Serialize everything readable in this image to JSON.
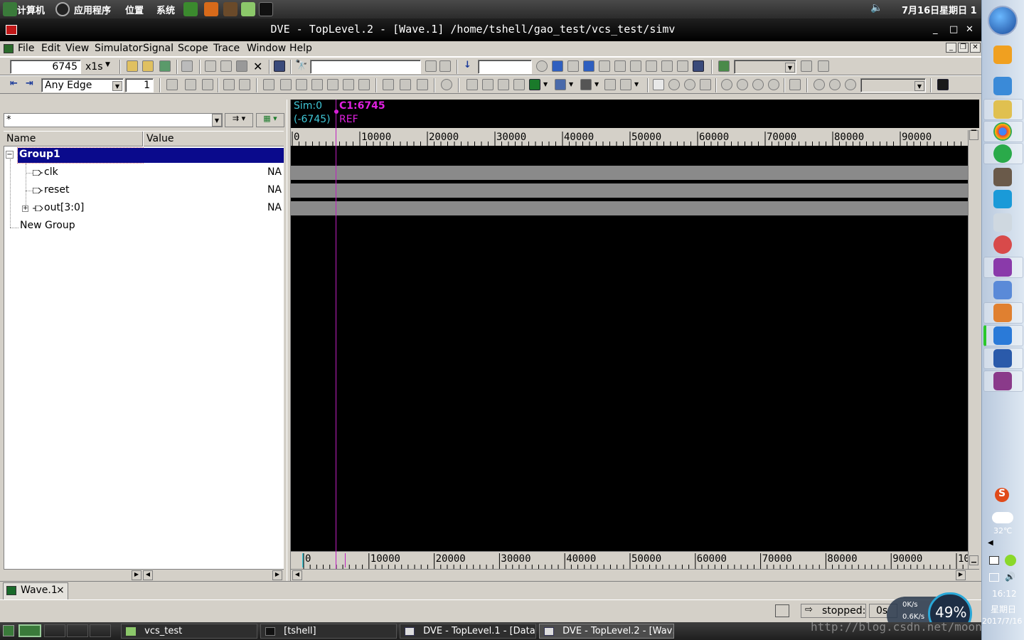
{
  "top_panel": {
    "computer": "计算机",
    "apps": "应用程序",
    "places": "位置",
    "system": "系统",
    "datetime": "7月16日星期日 1"
  },
  "window": {
    "title": "DVE - TopLevel.2 - [Wave.1]  /home/tshell/gao_test/vcs_test/simv",
    "minimize": "_",
    "maximize": "□",
    "close": "✕"
  },
  "menu": [
    "File",
    "Edit",
    "View",
    "Simulator",
    "Signal",
    "Scope",
    "Trace",
    "Window",
    "Help"
  ],
  "toolbar1": {
    "time_value": "6745",
    "time_unit": "x1s",
    "search_value": "",
    "goto_value": ""
  },
  "toolbar2": {
    "edge_select": "Any Edge",
    "edge_count": "1"
  },
  "signal_pane": {
    "filter_value": "*",
    "col_name": "Name",
    "col_value": "Value",
    "rows": [
      {
        "name": "Group1",
        "value": ""
      },
      {
        "name": "clk",
        "value": "NA"
      },
      {
        "name": "reset",
        "value": "NA"
      },
      {
        "name": "out[3:0]",
        "value": "NA"
      },
      {
        "name": "New Group",
        "value": ""
      }
    ]
  },
  "wave_header": {
    "sim": "Sim:0",
    "delta": "(-6745)",
    "cursor": "C1:6745",
    "ref": "REF"
  },
  "ruler_top": [
    "0",
    "10000",
    "20000",
    "30000",
    "40000",
    "50000",
    "60000",
    "70000",
    "80000",
    "90000"
  ],
  "ruler_bottom": [
    "0",
    "10000",
    "20000",
    "30000",
    "40000",
    "50000",
    "60000",
    "70000",
    "80000",
    "90000",
    "10"
  ],
  "tab": {
    "label": "Wave.1",
    "close": "×"
  },
  "status": {
    "state": "stopped:",
    "time": "0s"
  },
  "net": {
    "up": "0K/s",
    "down": "0.6K/s",
    "cpu": "49%"
  },
  "taskbar": {
    "tasks": [
      "vcs_test",
      "[tshell]",
      "DVE - TopLevel.1 - [Data…",
      "DVE - TopLevel.2 - [Wav…"
    ]
  },
  "sidebar": {
    "weather": "32℃",
    "time": "16:12",
    "weekday": "星期日",
    "date": "2017/7/16"
  },
  "watermark": "http://blog.csdn.net/moon9999"
}
